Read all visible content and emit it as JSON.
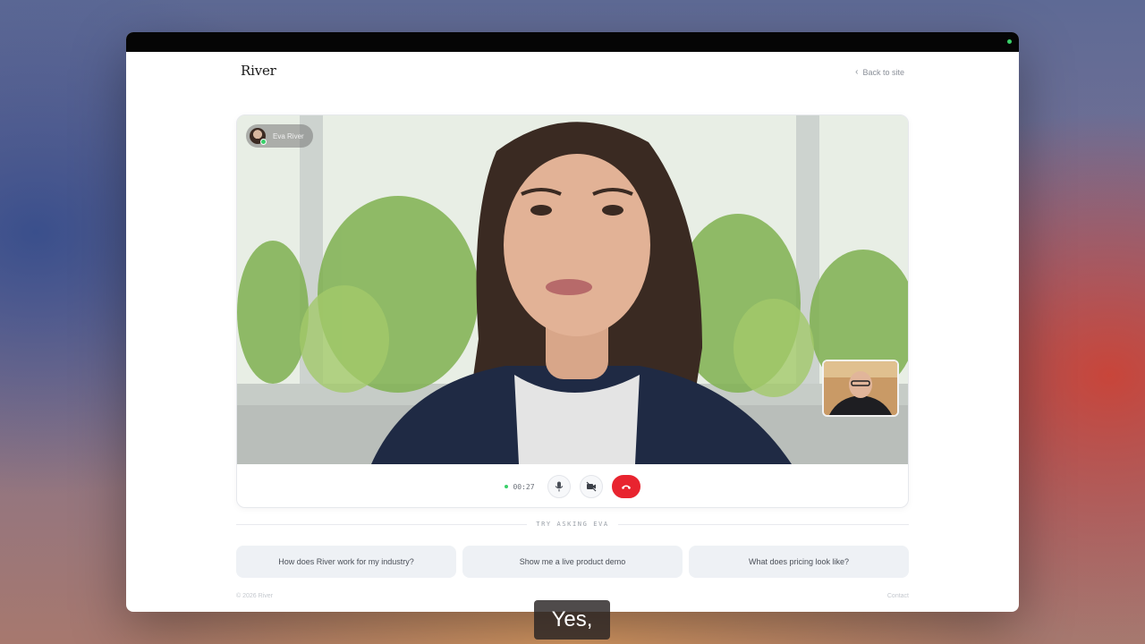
{
  "app": {
    "brand": "River",
    "back_link": "Back to site"
  },
  "call": {
    "participant_name": "Eva River",
    "elapsed": "00:27",
    "status_color": "#3ad06a",
    "end_color": "#e8242f"
  },
  "suggestions": {
    "label": "TRY ASKING EVA",
    "items": [
      "How does River work for my industry?",
      "Show me a live product demo",
      "What does pricing look like?"
    ]
  },
  "footer": {
    "copyright": "© 2026 River",
    "contact": "Contact"
  },
  "caption": "Yes,",
  "icons": {
    "back": "chevron-left-icon",
    "mic": "microphone-icon",
    "camera": "camera-off-icon",
    "end": "phone-hangup-icon"
  }
}
